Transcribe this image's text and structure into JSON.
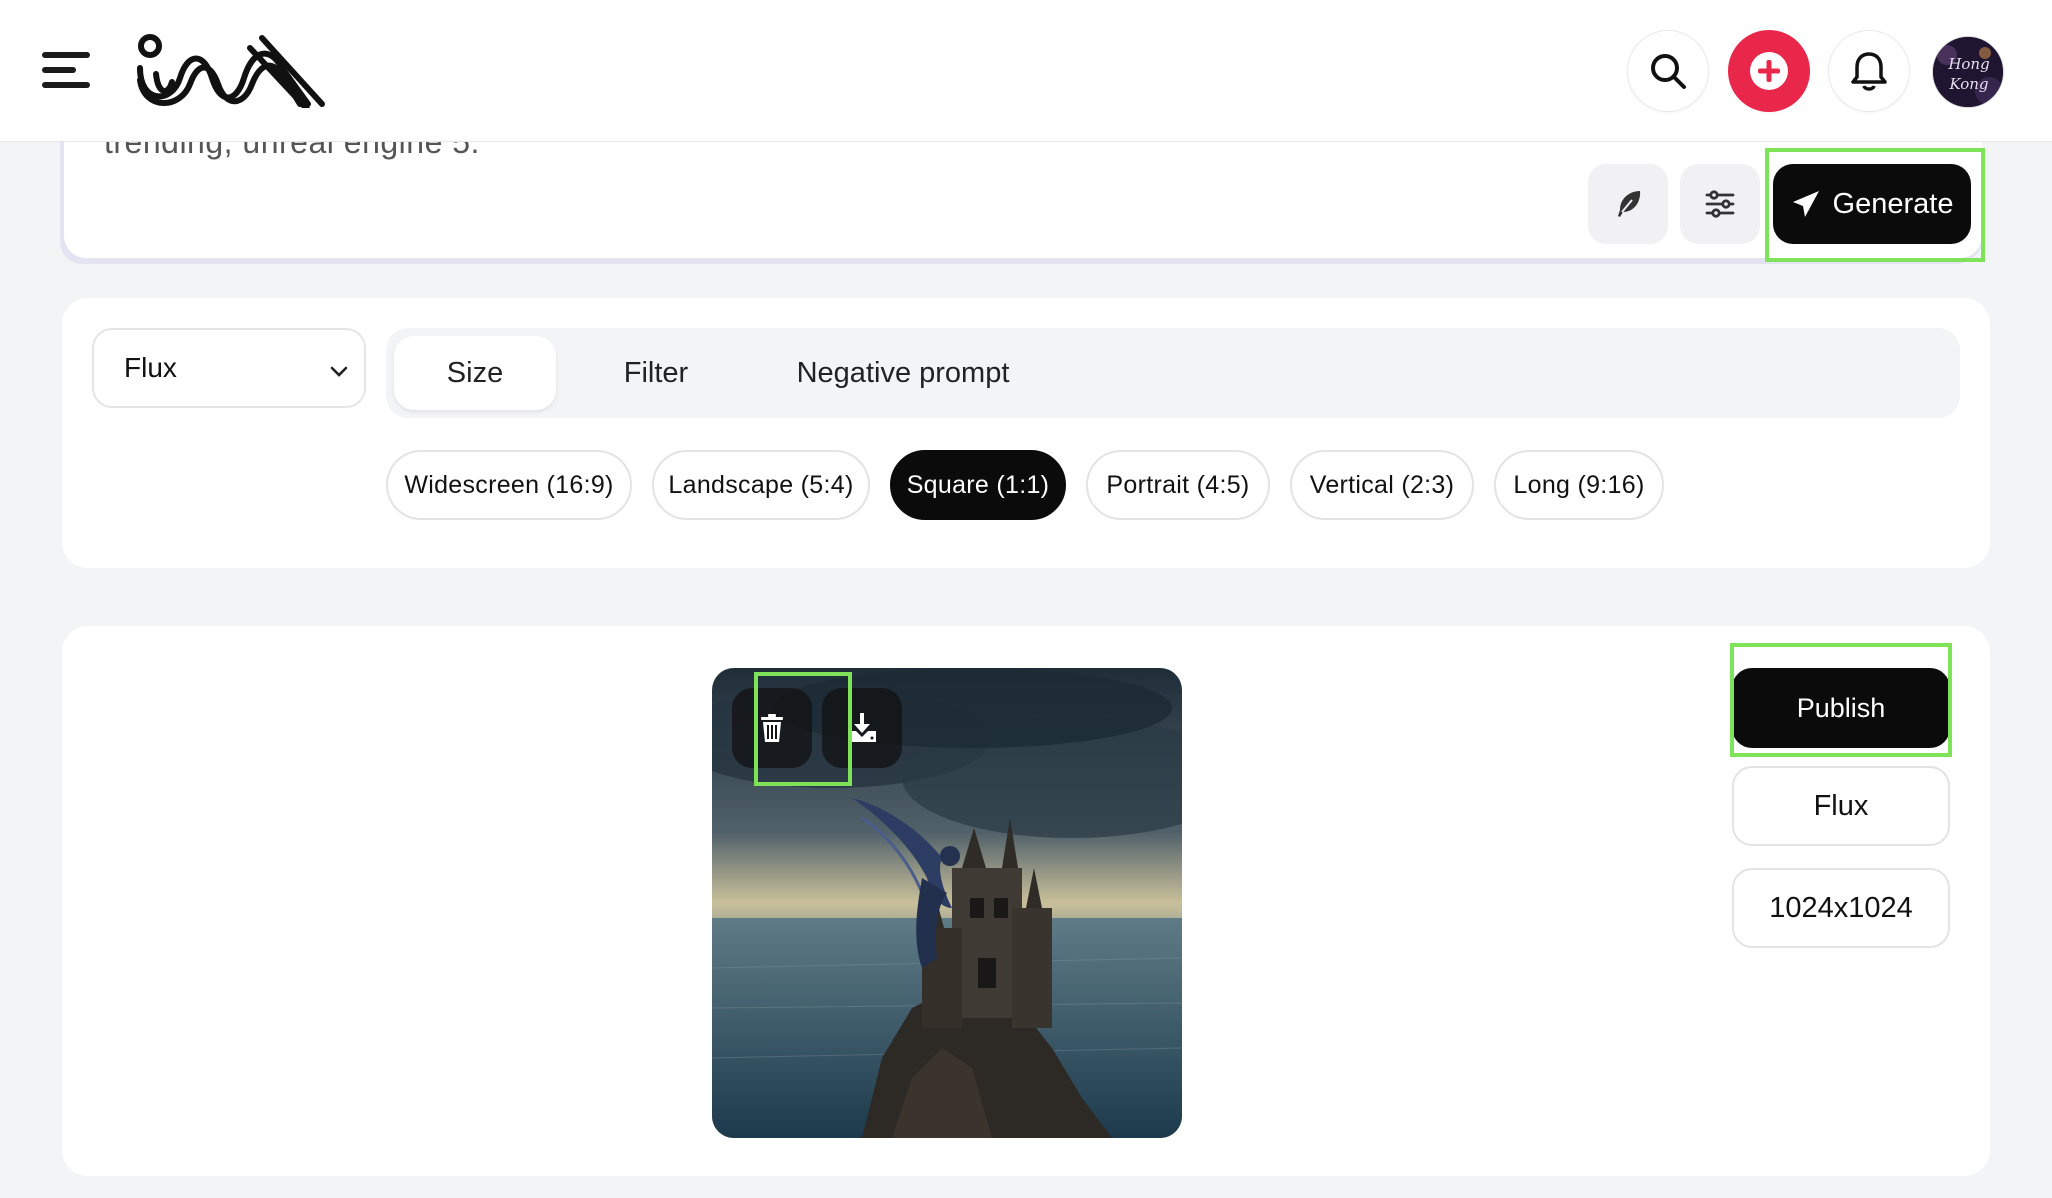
{
  "header": {
    "logo_icon": "ima-wave-logo",
    "avatar_text": "Hong Kong"
  },
  "prompt": {
    "text": "trending, unreal engine 5.",
    "generate_label": "Generate"
  },
  "options": {
    "model_selected": "Flux",
    "tabs": [
      {
        "label": "Size",
        "active": true
      },
      {
        "label": "Filter",
        "active": false
      },
      {
        "label": "Negative prompt",
        "active": false
      }
    ],
    "sizes": [
      {
        "label": "Widescreen (16:9)",
        "active": false
      },
      {
        "label": "Landscape (5:4)",
        "active": false
      },
      {
        "label": "Square (1:1)",
        "active": true
      },
      {
        "label": "Portrait (4:5)",
        "active": false
      },
      {
        "label": "Vertical (2:3)",
        "active": false
      },
      {
        "label": "Long (9:16)",
        "active": false
      }
    ]
  },
  "result": {
    "publish_label": "Publish",
    "model_label": "Flux",
    "resolution_label": "1024x1024"
  },
  "colors": {
    "accent_red": "#e8274b",
    "dark": "#0b0b0c",
    "highlight": "#7fe35a"
  }
}
